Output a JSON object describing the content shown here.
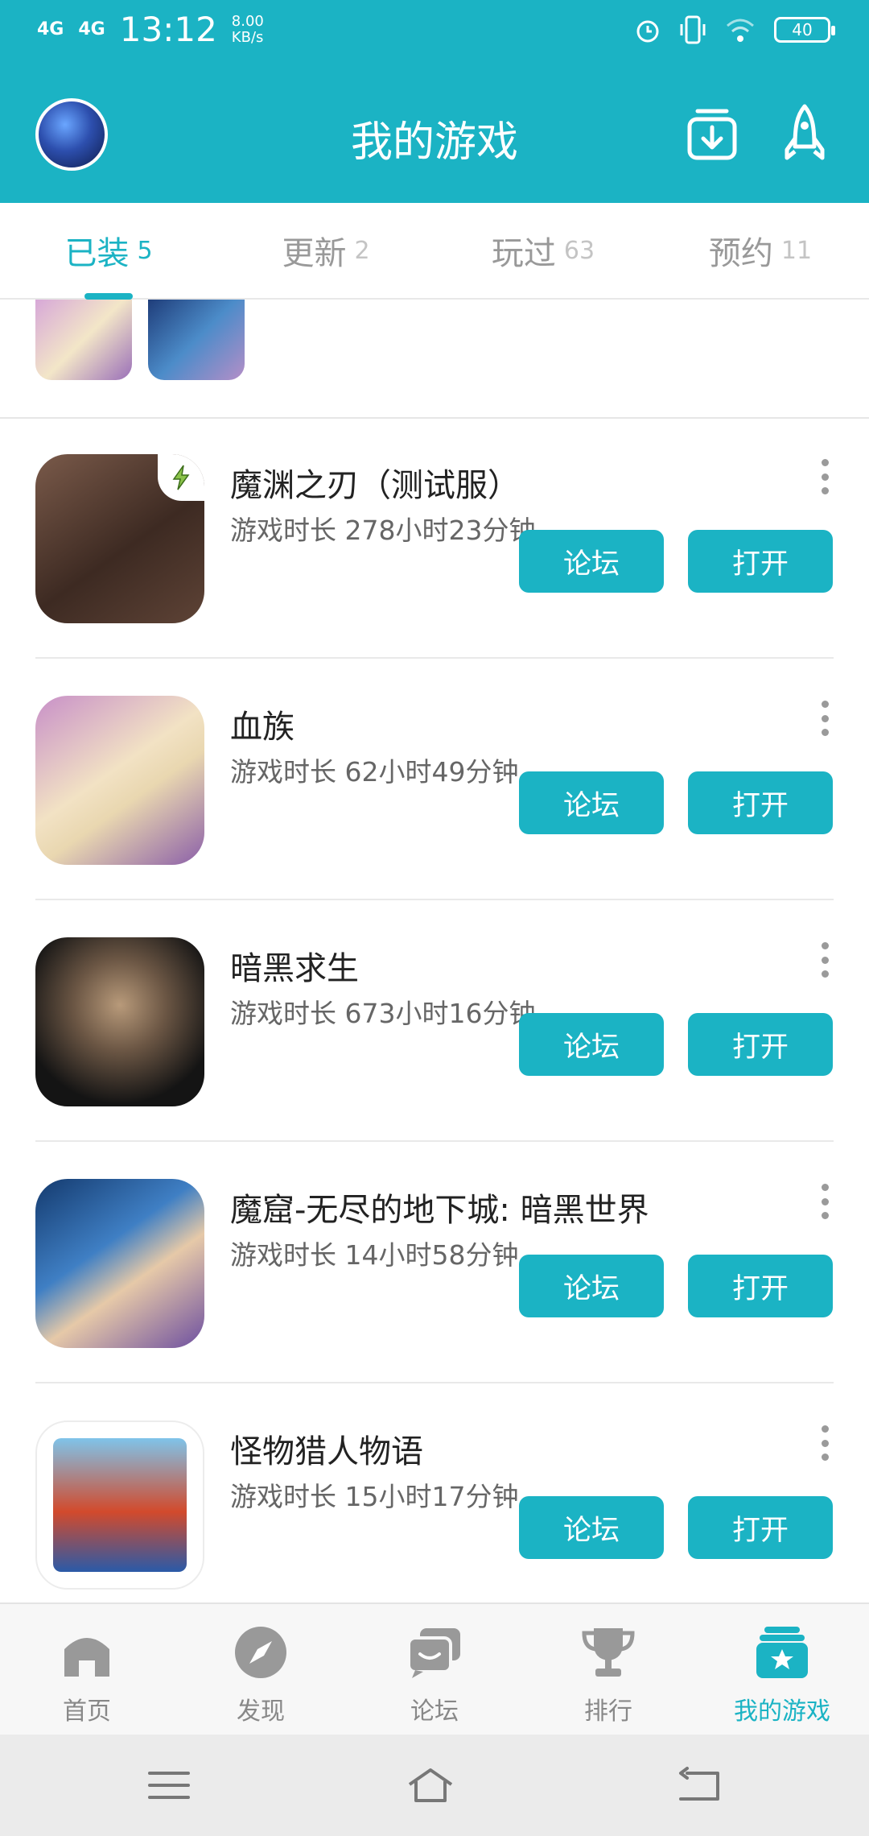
{
  "status_bar": {
    "network1": "4G",
    "network2": "4G",
    "time": "13:12",
    "speed_value": "8.00",
    "speed_unit": "KB/s",
    "battery": "40"
  },
  "header": {
    "title": "我的游戏"
  },
  "tabs": [
    {
      "label": "已装",
      "count": "5",
      "active": true
    },
    {
      "label": "更新",
      "count": "2",
      "active": false
    },
    {
      "label": "玩过",
      "count": "63",
      "active": false
    },
    {
      "label": "预约",
      "count": "11",
      "active": false
    }
  ],
  "games": [
    {
      "name": "魔渊之刃（测试服）",
      "playtime": "游戏时长 278小时23分钟",
      "forum_label": "论坛",
      "open_label": "打开",
      "icon": "game-icon-moyuan"
    },
    {
      "name": "血族",
      "playtime": "游戏时长 62小时49分钟",
      "forum_label": "论坛",
      "open_label": "打开",
      "icon": "game-icon-xuezu"
    },
    {
      "name": "暗黑求生",
      "playtime": "游戏时长 673小时16分钟",
      "forum_label": "论坛",
      "open_label": "打开",
      "icon": "game-icon-anhei"
    },
    {
      "name": "魔窟-无尽的地下城: 暗黑世界",
      "playtime": "游戏时长 14小时58分钟",
      "forum_label": "论坛",
      "open_label": "打开",
      "icon": "game-icon-moku"
    },
    {
      "name": "怪物猎人物语",
      "playtime": "游戏时长 15小时17分钟",
      "forum_label": "论坛",
      "open_label": "打开",
      "icon": "game-icon-monster-hunter"
    }
  ],
  "bottom_nav": [
    {
      "label": "首页",
      "icon": "home-icon",
      "active": false
    },
    {
      "label": "发现",
      "icon": "compass-icon",
      "active": false
    },
    {
      "label": "论坛",
      "icon": "chat-icon",
      "active": false
    },
    {
      "label": "排行",
      "icon": "trophy-icon",
      "active": false
    },
    {
      "label": "我的游戏",
      "icon": "my-games-icon",
      "active": true
    }
  ],
  "colors": {
    "accent": "#1bb3c4"
  }
}
